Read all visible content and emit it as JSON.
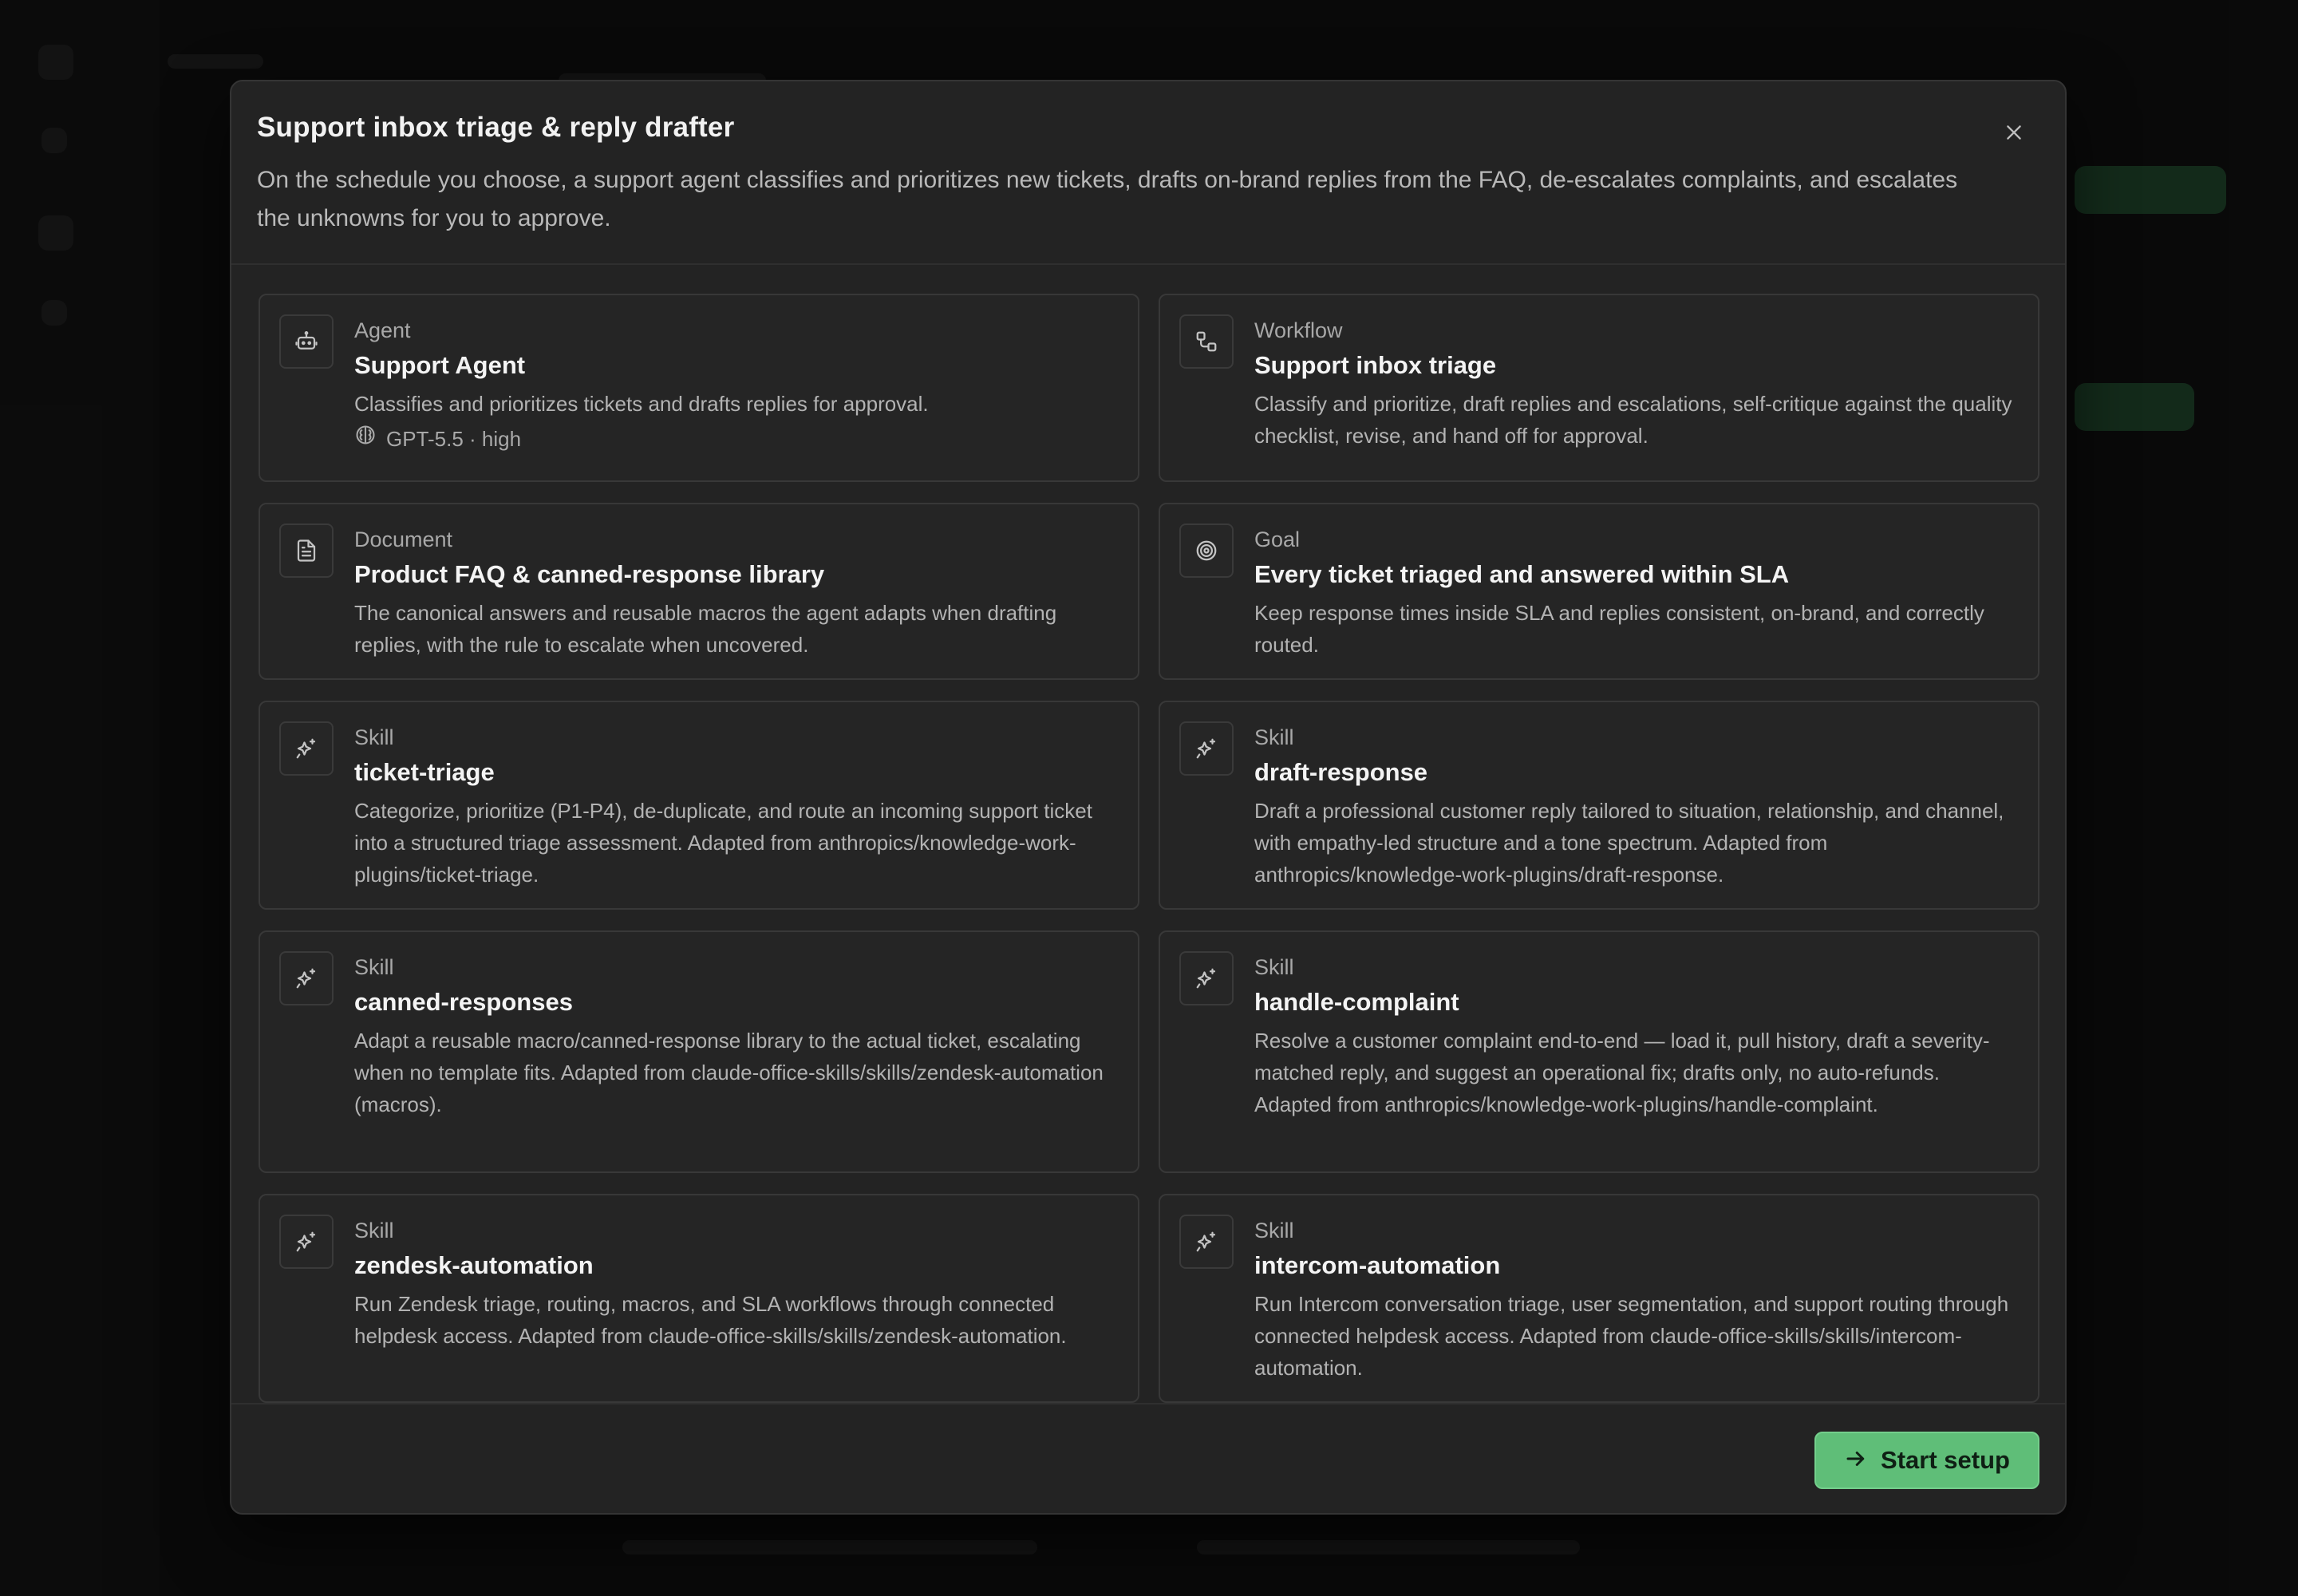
{
  "modal": {
    "title": "Support inbox triage & reply drafter",
    "description": "On the schedule you choose, a support agent classifies and prioritizes new tickets, drafts on-brand replies from the FAQ, de-escalates complaints, and escalates the unknowns for you to approve."
  },
  "cards": [
    {
      "kind": "Agent",
      "title": "Support Agent",
      "description": "Classifies and prioritizes tickets and drafts replies for approval.",
      "meta": "GPT-5.5 · high",
      "icon": "robot-icon"
    },
    {
      "kind": "Workflow",
      "title": "Support inbox triage",
      "description": "Classify and prioritize, draft replies and escalations, self-critique against the quality checklist, revise, and hand off for approval.",
      "icon": "workflow-icon"
    },
    {
      "kind": "Document",
      "title": "Product FAQ & canned-response library",
      "description": "The canonical answers and reusable macros the agent adapts when drafting replies, with the rule to escalate when uncovered.",
      "icon": "document-icon"
    },
    {
      "kind": "Goal",
      "title": "Every ticket triaged and answered within SLA",
      "description": "Keep response times inside SLA and replies consistent, on-brand, and correctly routed.",
      "icon": "target-icon"
    },
    {
      "kind": "Skill",
      "title": "ticket-triage",
      "description": "Categorize, prioritize (P1-P4), de-duplicate, and route an incoming support ticket into a structured triage assessment. Adapted from anthropics/knowledge-work-plugins/ticket-triage.",
      "icon": "sparkle-icon"
    },
    {
      "kind": "Skill",
      "title": "draft-response",
      "description": "Draft a professional customer reply tailored to situation, relationship, and channel, with empathy-led structure and a tone spectrum. Adapted from anthropics/knowledge-work-plugins/draft-response.",
      "icon": "sparkle-icon"
    },
    {
      "kind": "Skill",
      "title": "canned-responses",
      "description": "Adapt a reusable macro/canned-response library to the actual ticket, escalating when no template fits. Adapted from claude-office-skills/skills/zendesk-automation (macros).",
      "icon": "sparkle-icon"
    },
    {
      "kind": "Skill",
      "title": "handle-complaint",
      "description": "Resolve a customer complaint end-to-end — load it, pull history, draft a severity-matched reply, and suggest an operational fix; drafts only, no auto-refunds. Adapted from anthropics/knowledge-work-plugins/handle-complaint.",
      "icon": "sparkle-icon"
    },
    {
      "kind": "Skill",
      "title": "zendesk-automation",
      "description": "Run Zendesk triage, routing, macros, and SLA workflows through connected helpdesk access. Adapted from claude-office-skills/skills/zendesk-automation.",
      "icon": "sparkle-icon"
    },
    {
      "kind": "Skill",
      "title": "intercom-automation",
      "description": "Run Intercom conversation triage, user segmentation, and support routing through connected helpdesk access. Adapted from claude-office-skills/skills/intercom-automation.",
      "icon": "sparkle-icon"
    }
  ],
  "footer": {
    "start_label": "Start setup"
  },
  "colors": {
    "accent": "#5fbe78",
    "modal_bg": "#232323",
    "card_bg": "#252525"
  }
}
